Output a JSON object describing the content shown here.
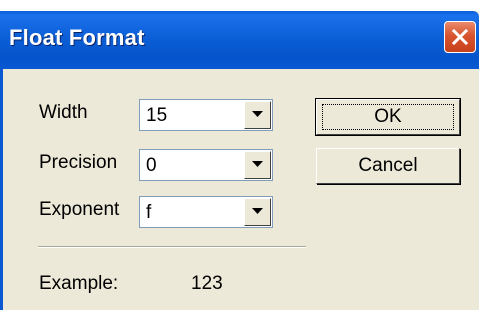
{
  "window": {
    "title": "Float Format"
  },
  "fields": {
    "width": {
      "label": "Width",
      "value": "15"
    },
    "precision": {
      "label": "Precision",
      "value": "0"
    },
    "exponent": {
      "label": "Exponent",
      "value": "f"
    }
  },
  "buttons": {
    "ok_label": "OK",
    "cancel_label": "Cancel"
  },
  "example": {
    "label": "Example:",
    "value": "123"
  },
  "icons": {
    "close": "close-icon",
    "dropdown": "chevron-down-icon"
  },
  "colors": {
    "titlebar": "#0a58d2",
    "dialog_face": "#ece9d8",
    "close_button": "#d8542f"
  }
}
